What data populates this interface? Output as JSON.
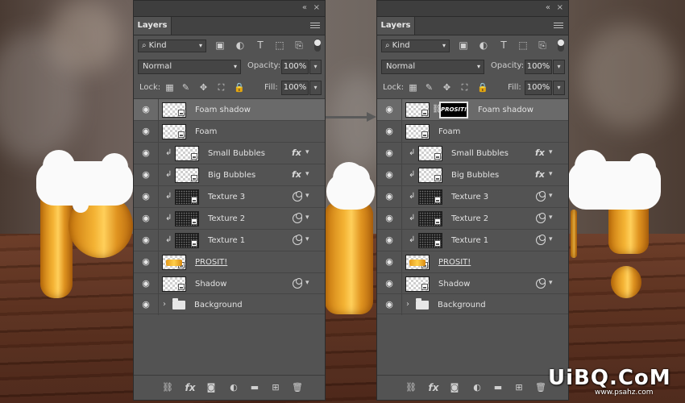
{
  "panels": [
    {
      "id": "left",
      "title": "Layers",
      "collapse_glyph": "«",
      "close_glyph": "×",
      "filter_kind": "Kind",
      "blend_mode": "Normal",
      "opacity_label": "Opacity:",
      "opacity_value": "100%",
      "lock_label": "Lock:",
      "fill_label": "Fill:",
      "fill_value": "100%",
      "layers": [
        {
          "name": "Foam shadow",
          "selected": true,
          "thumb": "checker",
          "clipped": false,
          "fx": false,
          "smart_filter": false,
          "mask": false
        },
        {
          "name": "Foam",
          "selected": false,
          "thumb": "checker",
          "clipped": false,
          "fx": false,
          "smart_filter": false,
          "mask": false
        },
        {
          "name": "Small Bubbles",
          "selected": false,
          "thumb": "checker",
          "clipped": true,
          "fx": true,
          "smart_filter": false,
          "mask": false
        },
        {
          "name": "Big Bubbles",
          "selected": false,
          "thumb": "checker",
          "clipped": true,
          "fx": true,
          "smart_filter": false,
          "mask": false
        },
        {
          "name": "Texture 3",
          "selected": false,
          "thumb": "dark",
          "clipped": true,
          "fx": false,
          "smart_filter": true,
          "mask": false
        },
        {
          "name": "Texture 2",
          "selected": false,
          "thumb": "dark",
          "clipped": true,
          "fx": false,
          "smart_filter": true,
          "mask": false
        },
        {
          "name": "Texture 1",
          "selected": false,
          "thumb": "dark",
          "clipped": true,
          "fx": false,
          "smart_filter": true,
          "mask": false
        },
        {
          "name": "PROSIT!",
          "selected": false,
          "thumb": "letters",
          "clipped": false,
          "fx": false,
          "smart_filter": false,
          "mask": false,
          "underlined": true
        },
        {
          "name": "Shadow",
          "selected": false,
          "thumb": "checker",
          "clipped": false,
          "fx": false,
          "smart_filter": true,
          "mask": false
        },
        {
          "name": "Background",
          "selected": false,
          "thumb": "folder",
          "clipped": false,
          "fx": false,
          "smart_filter": false,
          "mask": false,
          "group": true
        }
      ]
    },
    {
      "id": "right",
      "title": "Layers",
      "collapse_glyph": "«",
      "close_glyph": "×",
      "filter_kind": "Kind",
      "blend_mode": "Normal",
      "opacity_label": "Opacity:",
      "opacity_value": "100%",
      "lock_label": "Lock:",
      "fill_label": "Fill:",
      "fill_value": "100%",
      "layers": [
        {
          "name": "Foam shadow",
          "selected": true,
          "thumb": "checker",
          "clipped": false,
          "fx": false,
          "smart_filter": false,
          "mask": true,
          "mask_text": "PROSIT!"
        },
        {
          "name": "Foam",
          "selected": false,
          "thumb": "checker",
          "clipped": false,
          "fx": false,
          "smart_filter": false,
          "mask": false
        },
        {
          "name": "Small Bubbles",
          "selected": false,
          "thumb": "checker",
          "clipped": true,
          "fx": true,
          "smart_filter": false,
          "mask": false
        },
        {
          "name": "Big Bubbles",
          "selected": false,
          "thumb": "checker",
          "clipped": true,
          "fx": true,
          "smart_filter": false,
          "mask": false
        },
        {
          "name": "Texture 3",
          "selected": false,
          "thumb": "dark",
          "clipped": true,
          "fx": false,
          "smart_filter": true,
          "mask": false
        },
        {
          "name": "Texture 2",
          "selected": false,
          "thumb": "dark",
          "clipped": true,
          "fx": false,
          "smart_filter": true,
          "mask": false
        },
        {
          "name": "Texture 1",
          "selected": false,
          "thumb": "dark",
          "clipped": true,
          "fx": false,
          "smart_filter": true,
          "mask": false
        },
        {
          "name": "PROSIT!",
          "selected": false,
          "thumb": "letters",
          "clipped": false,
          "fx": false,
          "smart_filter": false,
          "mask": false,
          "underlined": true
        },
        {
          "name": "Shadow",
          "selected": false,
          "thumb": "checker",
          "clipped": false,
          "fx": false,
          "smart_filter": true,
          "mask": false
        },
        {
          "name": "Background",
          "selected": false,
          "thumb": "folder",
          "clipped": false,
          "fx": false,
          "smart_filter": false,
          "mask": false,
          "group": true
        }
      ]
    }
  ],
  "icons": {
    "filter_search": "search-icon",
    "filter_pixel": "image-filter-icon",
    "filter_adjustment": "adjustment-filter-icon",
    "filter_type": "type-filter-icon",
    "filter_shape": "shape-filter-icon",
    "filter_smart": "smart-object-filter-icon",
    "lock_transparent": "lock-transparent-pixels-icon",
    "lock_image": "lock-image-pixels-icon",
    "lock_position": "lock-position-icon",
    "lock_artboard": "lock-artboard-icon",
    "lock_all": "lock-all-icon",
    "bottom": [
      "link-layers-icon",
      "add-layer-style-icon",
      "add-mask-icon",
      "new-fill-adjustment-icon",
      "new-group-icon",
      "new-layer-icon",
      "delete-layer-icon"
    ]
  },
  "colors": {
    "panel_bg": "#535353",
    "selected_row": "#6a6a6a",
    "text": "#e2e2e2"
  },
  "watermark": {
    "main": "UiBQ.CoM",
    "sub": "www.psahz.com"
  }
}
